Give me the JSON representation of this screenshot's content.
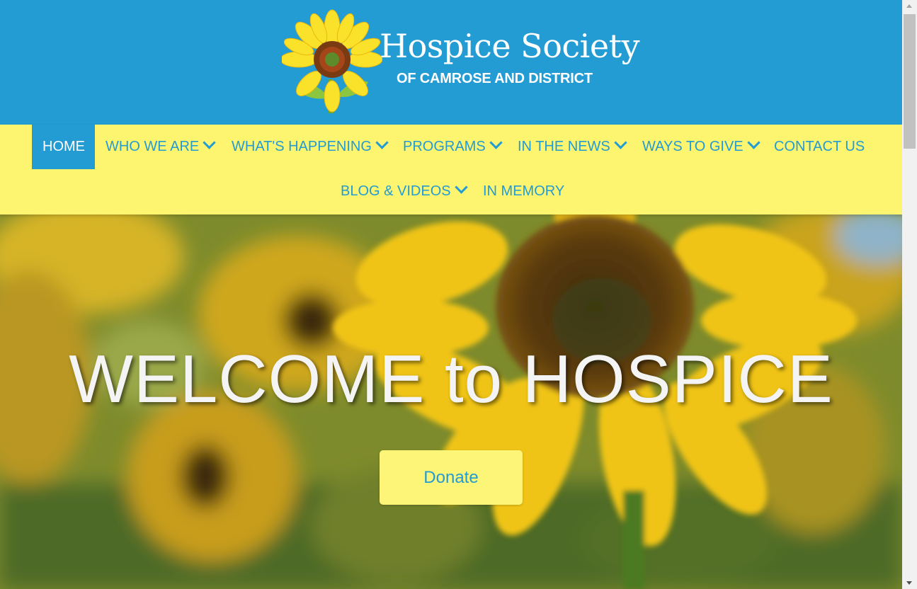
{
  "header": {
    "logo_title": "Hospice Society",
    "logo_subtitle": "OF CAMROSE AND DISTRICT",
    "background": "#239bd3"
  },
  "nav": {
    "background": "#fdf56f",
    "text_color": "#239bd3",
    "items": [
      {
        "label": "HOME",
        "active": true,
        "dropdown": false
      },
      {
        "label": "WHO WE ARE",
        "active": false,
        "dropdown": true
      },
      {
        "label": "WHAT'S HAPPENING",
        "active": false,
        "dropdown": true
      },
      {
        "label": "PROGRAMS",
        "active": false,
        "dropdown": true
      },
      {
        "label": "IN THE NEWS",
        "active": false,
        "dropdown": true
      },
      {
        "label": "WAYS TO GIVE",
        "active": false,
        "dropdown": true
      },
      {
        "label": "CONTACT US",
        "active": false,
        "dropdown": false
      },
      {
        "label": "BLOG & VIDEOS",
        "active": false,
        "dropdown": true
      },
      {
        "label": "IN MEMORY",
        "active": false,
        "dropdown": false
      }
    ]
  },
  "hero": {
    "title": "WELCOME to HOSPICE",
    "donate_label": "Donate",
    "background_image": "sunflower field"
  },
  "icons": {
    "logo": "sunflower-logo-icon",
    "dropdown": "chevron-down-icon",
    "scroll_up": "scroll-up-arrow-icon",
    "scroll_down": "scroll-down-arrow-icon"
  }
}
